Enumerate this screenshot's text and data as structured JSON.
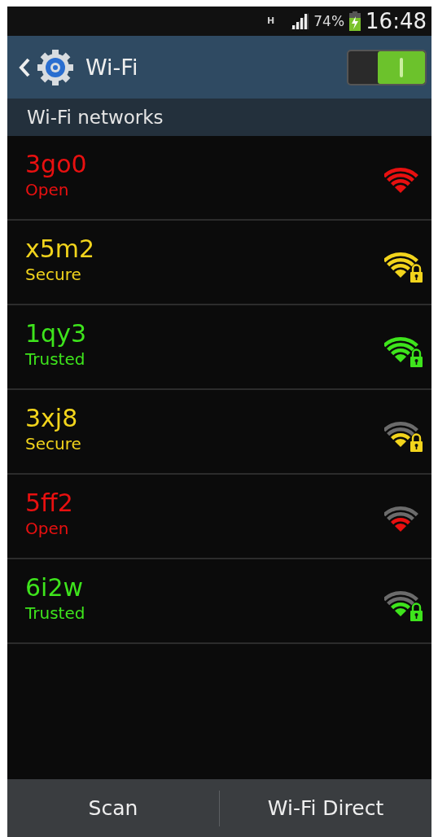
{
  "status_bar": {
    "network_type": "H",
    "battery": "74%",
    "time": "16:48"
  },
  "action_bar": {
    "title": "Wi-Fi",
    "wifi_on": true
  },
  "section_header": "Wi-Fi networks",
  "networks": [
    {
      "name": "3go0",
      "security": "Open",
      "color": "#e81010",
      "full_signal": true,
      "locked": false
    },
    {
      "name": "x5m2",
      "security": "Secure",
      "color": "#f2d41c",
      "full_signal": true,
      "locked": true
    },
    {
      "name": "1qy3",
      "security": "Trusted",
      "color": "#3ee41c",
      "full_signal": true,
      "locked": true
    },
    {
      "name": "3xj8",
      "security": "Secure",
      "color": "#f2d41c",
      "full_signal": false,
      "locked": true
    },
    {
      "name": "5ff2",
      "security": "Open",
      "color": "#e81010",
      "full_signal": false,
      "locked": false
    },
    {
      "name": "6i2w",
      "security": "Trusted",
      "color": "#3ee41c",
      "full_signal": false,
      "locked": true
    }
  ],
  "bottom_buttons": [
    "Scan",
    "Wi-Fi Direct"
  ]
}
